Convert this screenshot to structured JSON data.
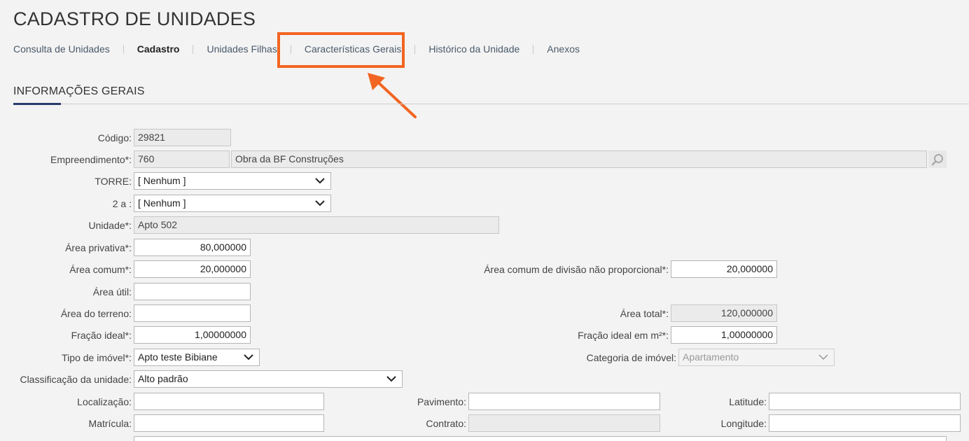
{
  "page": {
    "title": "CADASTRO DE UNIDADES"
  },
  "tabs": [
    {
      "label": "Consulta de Unidades"
    },
    {
      "label": "Cadastro"
    },
    {
      "label": "Unidades Filhas"
    },
    {
      "label": "Características Gerais"
    },
    {
      "label": "Histórico da Unidade"
    },
    {
      "label": "Anexos"
    }
  ],
  "section": {
    "title": "INFORMAÇÕES GERAIS"
  },
  "form": {
    "codigo": {
      "label": "Código:",
      "value": "29821"
    },
    "empreendimento": {
      "label": "Empreendimento*:",
      "code": "760",
      "name": "Obra da BF Construções"
    },
    "torre": {
      "label": "TORRE:",
      "value": "[ Nenhum ]"
    },
    "dois_a": {
      "label": "2 a :",
      "value": "[ Nenhum ]"
    },
    "unidade": {
      "label": "Unidade*:",
      "value": "Apto 502"
    },
    "area_privativa": {
      "label": "Área privativa*:",
      "value": "80,000000"
    },
    "area_comum": {
      "label": "Área comum*:",
      "value": "20,000000"
    },
    "area_comum_div": {
      "label": "Área comum de divisão não proporcional*:",
      "value": "20,000000"
    },
    "area_util": {
      "label": "Área útil:",
      "value": ""
    },
    "area_terreno": {
      "label": "Área do terreno:",
      "value": ""
    },
    "area_total": {
      "label": "Área total*:",
      "value": "120,000000"
    },
    "fracao_ideal": {
      "label": "Fração ideal*:",
      "value": "1,00000000"
    },
    "fracao_ideal_m2": {
      "label": "Fração ideal em m²*:",
      "value": "1,00000000"
    },
    "tipo_imovel": {
      "label": "Tipo de imóvel*:",
      "value": "Apto teste Bibiane"
    },
    "categoria_imovel": {
      "label": "Categoria de imóvel:",
      "value": "Apartamento"
    },
    "classificacao": {
      "label": "Classificação da unidade:",
      "value": "Alto padrão"
    },
    "localizacao": {
      "label": "Localização:",
      "value": ""
    },
    "pavimento": {
      "label": "Pavimento:",
      "value": ""
    },
    "latitude": {
      "label": "Latitude:",
      "value": ""
    },
    "matricula": {
      "label": "Matrícula:",
      "value": ""
    },
    "contrato": {
      "label": "Contrato:",
      "value": ""
    },
    "longitude": {
      "label": "Longitude:",
      "value": ""
    }
  },
  "colors": {
    "highlight": "#f26522",
    "section_underline": "#2a3b6b"
  },
  "icons": {
    "search": "magnifier-icon",
    "dropdown": "chevron-down-icon",
    "annotation": "arrow-icon"
  }
}
